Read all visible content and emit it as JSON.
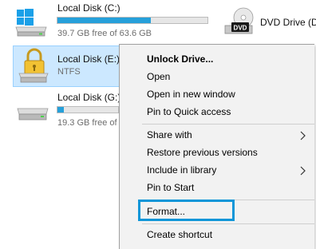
{
  "drives": {
    "c": {
      "name": "Local Disk (C:)",
      "free": "39.7 GB free of 63.6 GB",
      "used_fraction": 0.62
    },
    "e": {
      "name": "Local Disk (E:)",
      "fs": "NTFS"
    },
    "g": {
      "name": "Local Disk (G:)",
      "free": "19.3 GB free of 19.5 GB",
      "used_fraction": 0.1
    },
    "dvd": {
      "name": "DVD Drive (D",
      "badge": "DVD"
    }
  },
  "menu": {
    "unlock": "Unlock Drive...",
    "open": "Open",
    "open_new_window": "Open in new window",
    "pin_quick": "Pin to Quick access",
    "share_with": "Share with",
    "restore": "Restore previous versions",
    "include_library": "Include in library",
    "pin_start": "Pin to Start",
    "format": "Format...",
    "create_shortcut": "Create shortcut"
  },
  "colors": {
    "accent": "#26a0da",
    "highlight": "#0d96d8",
    "selection": "#cce8ff"
  }
}
